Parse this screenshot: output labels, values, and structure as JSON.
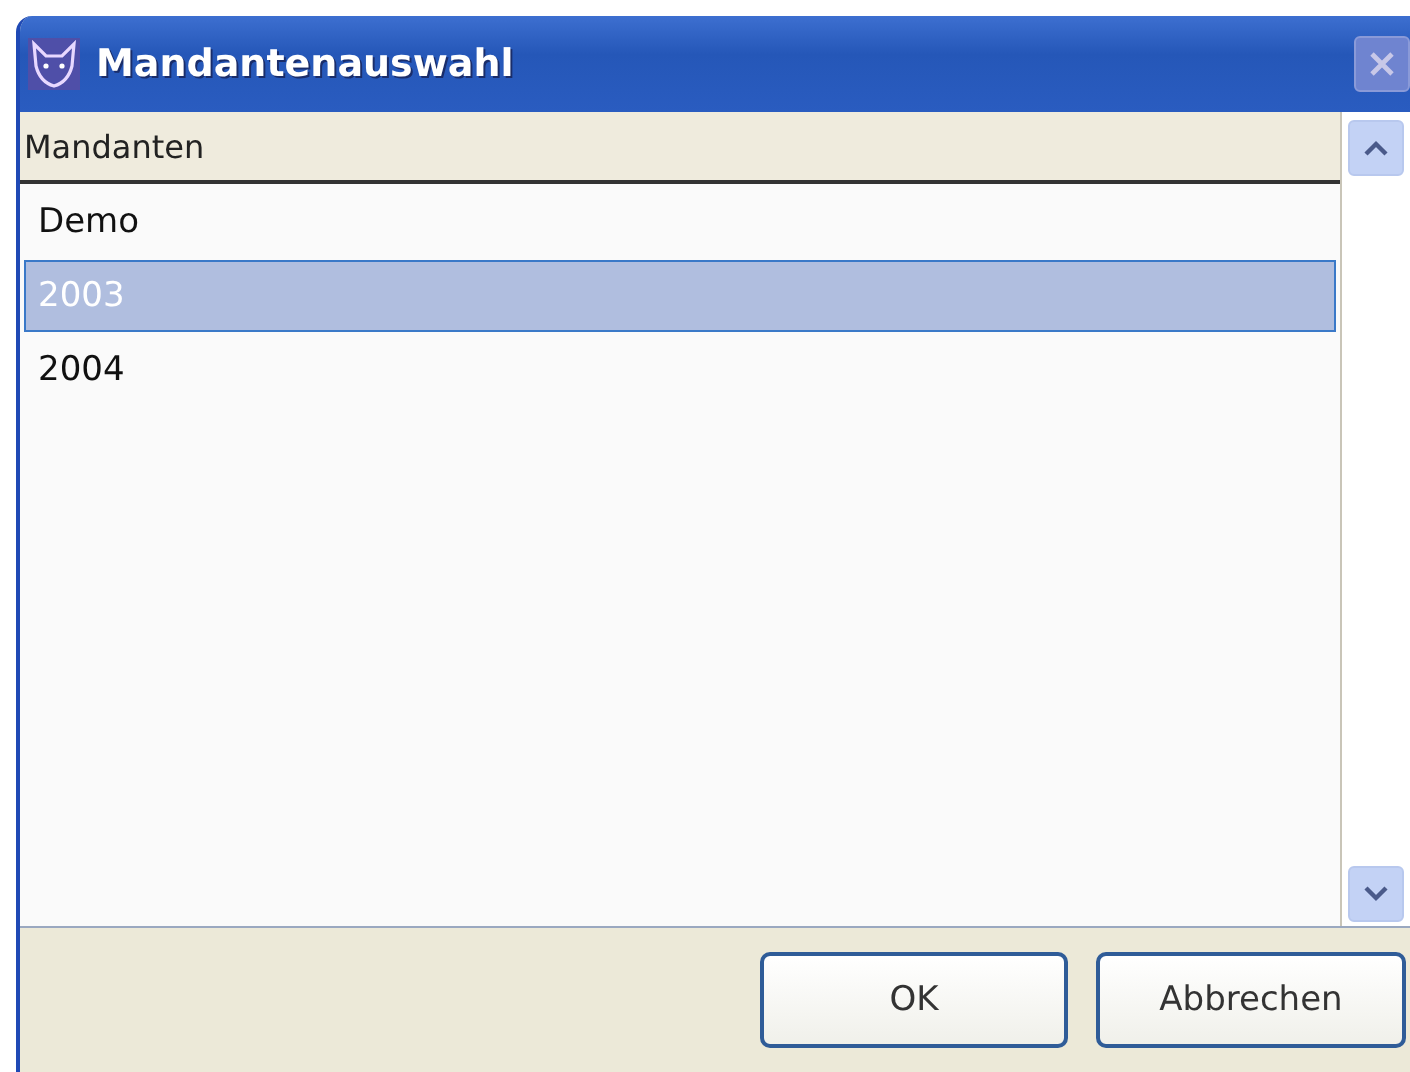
{
  "window": {
    "title": "Mandantenauswahl"
  },
  "table": {
    "columns": [
      "Mandanten"
    ],
    "rows": [
      {
        "cells": [
          "Demo"
        ],
        "selected": false
      },
      {
        "cells": [
          "2003"
        ],
        "selected": true
      },
      {
        "cells": [
          "2004"
        ],
        "selected": false
      }
    ]
  },
  "buttons": [
    {
      "label": "OK",
      "kind": "ok"
    },
    {
      "label": "Abbrechen",
      "kind": "cancel"
    }
  ]
}
